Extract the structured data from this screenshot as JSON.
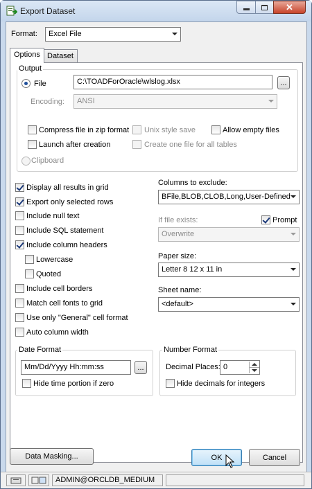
{
  "window": {
    "title": "Export Dataset"
  },
  "format": {
    "label": "Format:",
    "value": "Excel File"
  },
  "tabs": [
    {
      "label": "Options"
    },
    {
      "label": "Dataset"
    }
  ],
  "output": {
    "title": "Output",
    "file_label": "File",
    "file_path": "C:\\TOADForOracle\\wlslog.xlsx",
    "browse_label": "...",
    "encoding_label": "Encoding:",
    "encoding_value": "ANSI",
    "compress_label": "Compress file in zip format",
    "unix_label": "Unix style save",
    "allow_empty_label": "Allow empty files",
    "launch_label": "Launch after creation",
    "one_file_label": "Create one file for all tables",
    "clipboard_label": "Clipboard"
  },
  "options": {
    "display_all": "Display all results in grid",
    "export_selected": "Export only selected rows",
    "include_null": "Include null text",
    "include_sql": "Include SQL statement",
    "include_headers": "Include column headers",
    "lowercase": "Lowercase",
    "quoted": "Quoted",
    "include_borders": "Include cell borders",
    "match_fonts": "Match cell fonts to grid",
    "general_format": "Use only \"General\" cell format",
    "auto_width": "Auto column width"
  },
  "columns_exclude": {
    "label": "Columns to exclude:",
    "value": "BFile,BLOB,CLOB,Long,User-Defined"
  },
  "if_exists": {
    "label": "If file exists:",
    "prompt_label": "Prompt",
    "value": "Overwrite"
  },
  "paper_size": {
    "label": "Paper size:",
    "value": "Letter 8 12 x 11 in"
  },
  "sheet_name": {
    "label": "Sheet name:",
    "value": "<default>"
  },
  "date_format": {
    "title": "Date Format",
    "value": "Mm/Dd/Yyyy Hh:mm:ss",
    "browse_label": "...",
    "hide_time_label": "Hide time portion if zero"
  },
  "number_format": {
    "title": "Number Format",
    "decimal_label": "Decimal Places:",
    "decimal_value": "0",
    "hide_decimals_label": "Hide decimals for integers"
  },
  "buttons": {
    "data_masking": "Data Masking...",
    "ok": "OK",
    "cancel": "Cancel"
  },
  "status": {
    "connection": "ADMIN@ORCLDB_MEDIUM"
  }
}
